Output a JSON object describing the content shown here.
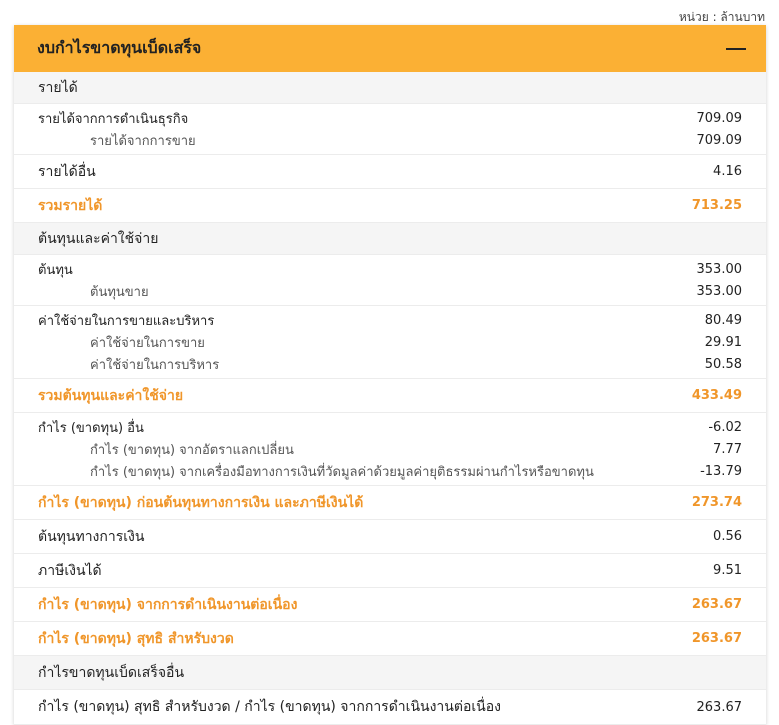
{
  "unit_label": "หน่วย : ล้านบาท",
  "panel_title": "งบกำไรขาดทุนเบ็ดเสร็จ",
  "collapse_icon": "minus-icon",
  "accent_color": "#fbb034",
  "total_color": "#f0962a",
  "sections": {
    "revenue_header": "รายได้",
    "revenue_ops": {
      "label": "รายได้จากการดำเนินธุรกิจ",
      "value": "709.09"
    },
    "revenue_sales": {
      "label": "รายได้จากการขาย",
      "value": "709.09"
    },
    "revenue_other": {
      "label": "รายได้อื่น",
      "value": "4.16"
    },
    "revenue_total": {
      "label": "รวมรายได้",
      "value": "713.25"
    },
    "cost_header": "ต้นทุนและค่าใช้จ่าย",
    "cost": {
      "label": "ต้นทุน",
      "value": "353.00"
    },
    "cost_sales": {
      "label": "ต้นทุนขาย",
      "value": "353.00"
    },
    "sga": {
      "label": "ค่าใช้จ่ายในการขายและบริหาร",
      "value": "80.49"
    },
    "selling": {
      "label": "ค่าใช้จ่ายในการขาย",
      "value": "29.91"
    },
    "admin": {
      "label": "ค่าใช้จ่ายในการบริหาร",
      "value": "50.58"
    },
    "cost_total": {
      "label": "รวมต้นทุนและค่าใช้จ่าย",
      "value": "433.49"
    },
    "other_gl": {
      "label": "กำไร (ขาดทุน) อื่น",
      "value": "-6.02"
    },
    "fx_gl": {
      "label": "กำไร (ขาดทุน) จากอัตราแลกเปลี่ยน",
      "value": "7.77"
    },
    "fv_gl": {
      "label": "กำไร (ขาดทุน) จากเครื่องมือทางการเงินที่วัดมูลค่าด้วยมูลค่ายุติธรรมผ่านกำไรหรือขาดทุน",
      "value": "-13.79"
    },
    "ebt": {
      "label": "กำไร (ขาดทุน) ก่อนต้นทุนทางการเงิน และภาษีเงินได้",
      "value": "273.74"
    },
    "finance_cost": {
      "label": "ต้นทุนทางการเงิน",
      "value": "0.56"
    },
    "income_tax": {
      "label": "ภาษีเงินได้",
      "value": "9.51"
    },
    "cont_ops": {
      "label": "กำไร (ขาดทุน) จากการดำเนินงานต่อเนื่อง",
      "value": "263.67"
    },
    "net_profit": {
      "label": "กำไร (ขาดทุน) สุทธิ สำหรับงวด",
      "value": "263.67"
    },
    "oci_header": "กำไรขาดทุนเบ็ดเสร็จอื่น",
    "net_vs_cont": {
      "label": "กำไร (ขาดทุน) สุทธิ สำหรับงวด / กำไร (ขาดทุน) จากการดำเนินงานต่อเนื่อง",
      "value": "263.67"
    }
  }
}
